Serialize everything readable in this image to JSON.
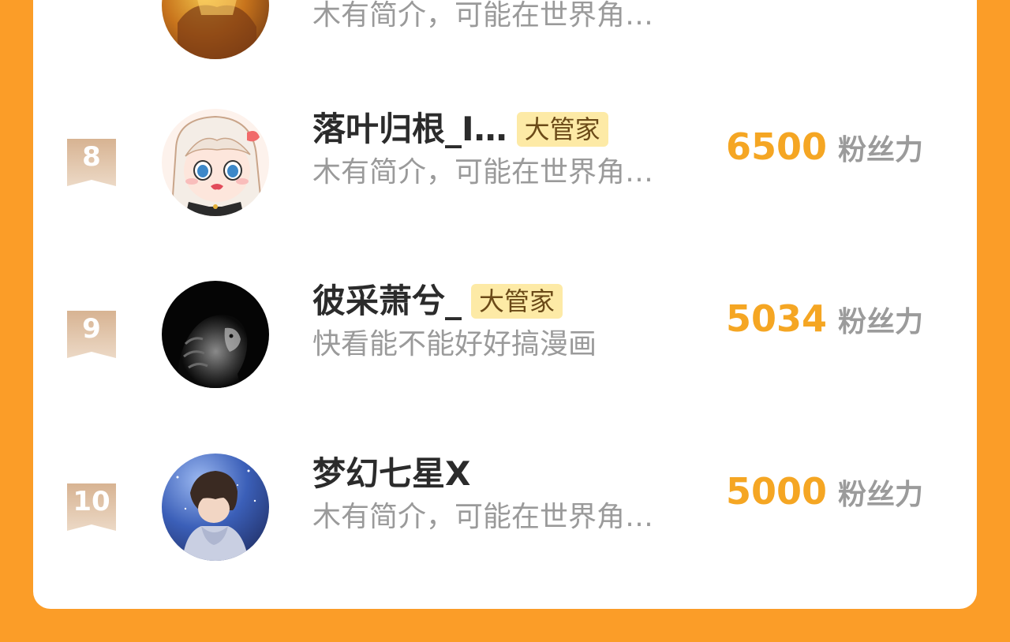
{
  "entries": [
    {
      "bio": "木有简介，可能在世界角…"
    },
    {
      "rank": "8",
      "name": "落叶归根_I…",
      "badge": "大管家",
      "bio": "木有简介，可能在世界角…",
      "fans": "6500",
      "fans_unit": "粉丝力",
      "avatar": "anime-girl-avatar"
    },
    {
      "rank": "9",
      "name": "彼采萧兮_",
      "badge": "大管家",
      "bio": "快看能不能好好搞漫画",
      "fans": "5034",
      "fans_unit": "粉丝力",
      "avatar": "lion-avatar"
    },
    {
      "rank": "10",
      "name": "梦幻七星X",
      "bio": "木有简介，可能在世界角…",
      "fans": "5000",
      "fans_unit": "粉丝力",
      "avatar": "starry-boy-avatar"
    }
  ],
  "colors": {
    "background": "#fb9d28",
    "card": "#ffffff",
    "fans_value": "#f5a623",
    "badge_bg": "#fdeaa6",
    "rank_ribbon": "#d9b99a"
  }
}
